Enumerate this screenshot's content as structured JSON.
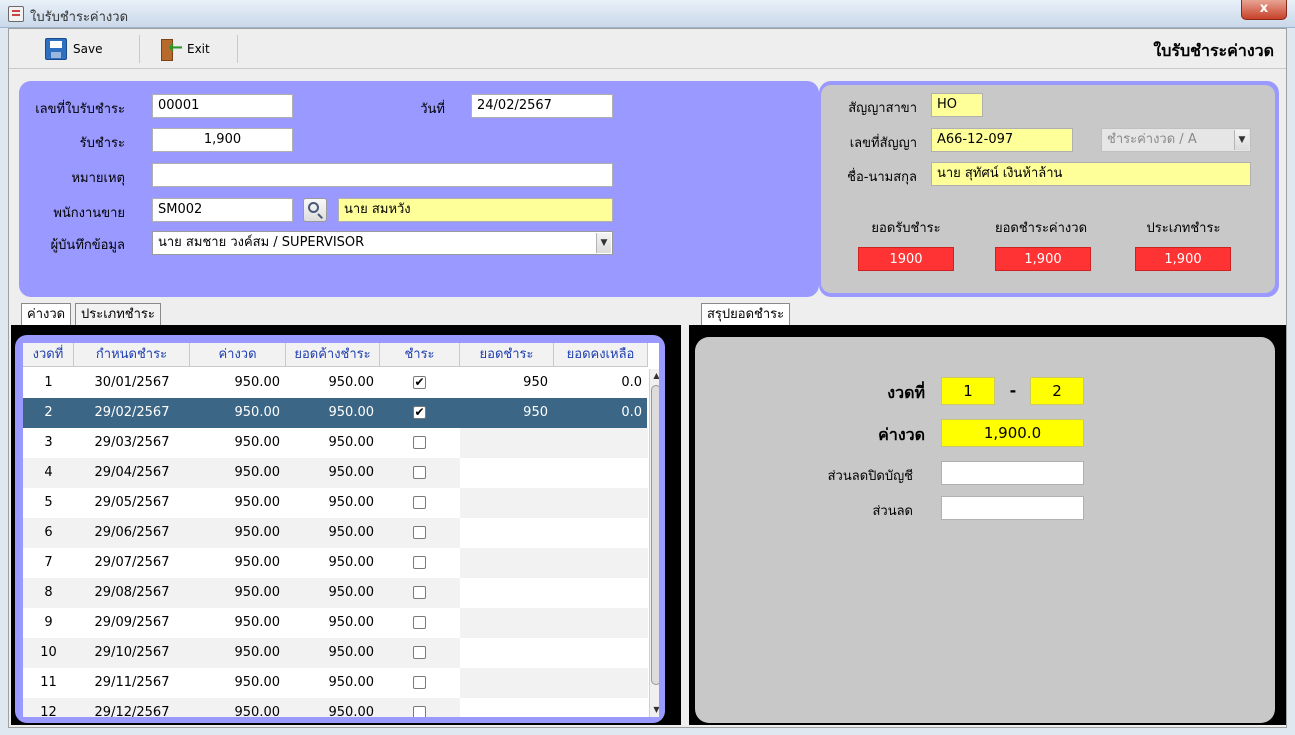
{
  "window": {
    "title": "ใบรับชำระค่างวด",
    "close_label": "x"
  },
  "toolbar": {
    "save_label": "Save",
    "exit_label": "Exit",
    "form_title": "ใบรับชำระค่างวด"
  },
  "receipt": {
    "no_label": "เลขที่ใบรับชำระ",
    "no_value": "00001",
    "date_label": "วันที่",
    "date_value": "24/02/2567",
    "pay_label": "รับชำระ",
    "pay_value": "1,900",
    "note_label": "หมายเหตุ",
    "note_value": "",
    "salesman_label": "พนักงานขาย",
    "salesman_code": "SM002",
    "salesman_name": "นาย สมหวัง",
    "recorder_label": "ผู้บันทึกข้อมูล",
    "recorder_value": "นาย สมชาย วงค์สม / SUPERVISOR"
  },
  "contract": {
    "branch_label": "สัญญาสาขา",
    "branch_value": "HO",
    "no_label": "เลขที่สัญญา",
    "no_value": "A66-12-097",
    "type_combo": "ชำระค่างวด / A",
    "name_label": "ชื่อ-นามสกุล",
    "name_value": "นาย สุทัศน์ เงินห้าล้าน",
    "totals": [
      {
        "label": "ยอดรับชำระ",
        "value": "1900"
      },
      {
        "label": "ยอดชำระค่างวด",
        "value": "1,900"
      },
      {
        "label": "ประเภทชำระ",
        "value": "1,900"
      }
    ]
  },
  "tabs_left": [
    {
      "label": "ค่างวด"
    },
    {
      "label": "ประเภทชำระ"
    }
  ],
  "tab_right": {
    "label": "สรุปยอดชำระ"
  },
  "table": {
    "columns": [
      "งวดที่",
      "กำหนดชำระ",
      "ค่างวด",
      "ยอดค้างชำระ",
      "ชำระ",
      "ยอดชำระ",
      "ยอดคงเหลือ"
    ],
    "rows": [
      {
        "no": "1",
        "due": "30/01/2567",
        "amount": "950.00",
        "outstanding": "950.00",
        "checked": true,
        "paid": "950",
        "remaining": "0.0"
      },
      {
        "no": "2",
        "due": "29/02/2567",
        "amount": "950.00",
        "outstanding": "950.00",
        "checked": true,
        "paid": "950",
        "remaining": "0.0"
      },
      {
        "no": "3",
        "due": "29/03/2567",
        "amount": "950.00",
        "outstanding": "950.00",
        "checked": false,
        "paid": "",
        "remaining": ""
      },
      {
        "no": "4",
        "due": "29/04/2567",
        "amount": "950.00",
        "outstanding": "950.00",
        "checked": false,
        "paid": "",
        "remaining": ""
      },
      {
        "no": "5",
        "due": "29/05/2567",
        "amount": "950.00",
        "outstanding": "950.00",
        "checked": false,
        "paid": "",
        "remaining": ""
      },
      {
        "no": "6",
        "due": "29/06/2567",
        "amount": "950.00",
        "outstanding": "950.00",
        "checked": false,
        "paid": "",
        "remaining": ""
      },
      {
        "no": "7",
        "due": "29/07/2567",
        "amount": "950.00",
        "outstanding": "950.00",
        "checked": false,
        "paid": "",
        "remaining": ""
      },
      {
        "no": "8",
        "due": "29/08/2567",
        "amount": "950.00",
        "outstanding": "950.00",
        "checked": false,
        "paid": "",
        "remaining": ""
      },
      {
        "no": "9",
        "due": "29/09/2567",
        "amount": "950.00",
        "outstanding": "950.00",
        "checked": false,
        "paid": "",
        "remaining": ""
      },
      {
        "no": "10",
        "due": "29/10/2567",
        "amount": "950.00",
        "outstanding": "950.00",
        "checked": false,
        "paid": "",
        "remaining": ""
      },
      {
        "no": "11",
        "due": "29/11/2567",
        "amount": "950.00",
        "outstanding": "950.00",
        "checked": false,
        "paid": "",
        "remaining": ""
      },
      {
        "no": "12",
        "due": "29/12/2567",
        "amount": "950.00",
        "outstanding": "950.00",
        "checked": false,
        "paid": "",
        "remaining": ""
      }
    ],
    "selected_row": 1
  },
  "summary": {
    "period_label": "งวดที่",
    "period_from": "1",
    "period_sep": "-",
    "period_to": "2",
    "amount_label": "ค่างวด",
    "amount_value": "1,900.0",
    "close_discount_label": "ส่วนลดปิดบัญชี",
    "close_discount_value": "",
    "discount_label": "ส่วนลด",
    "discount_value": ""
  },
  "colors": {
    "panel_purple": "#9999ff",
    "yellow_field": "#ffff99",
    "highlight_yellow": "#ffff00",
    "red_total": "#ff3333",
    "selected_row": "#3c6685",
    "header_text": "#1f3fb0"
  },
  "icons": [
    "save-icon",
    "exit-icon",
    "search-icon",
    "checkbox-icon",
    "chevron-down-icon"
  ]
}
